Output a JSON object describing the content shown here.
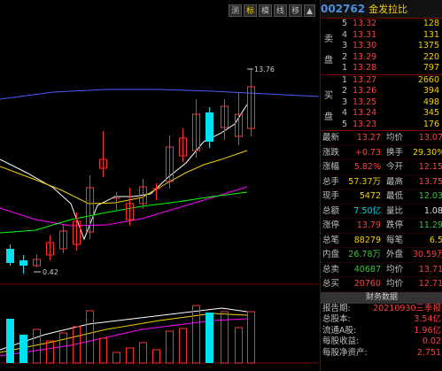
{
  "toolbar": {
    "buttons": [
      "测",
      "标",
      "模",
      "线",
      "移",
      "▲"
    ]
  },
  "stock": {
    "code": "002762",
    "name": "金发拉比"
  },
  "orderbook": {
    "sell_label": [
      "卖",
      "盘"
    ],
    "buy_label": [
      "买",
      "盘"
    ],
    "asks": [
      {
        "lvl": "5",
        "price": "13.32",
        "vol": "128"
      },
      {
        "lvl": "4",
        "price": "13.31",
        "vol": "131"
      },
      {
        "lvl": "3",
        "price": "13.30",
        "vol": "1375"
      },
      {
        "lvl": "2",
        "price": "13.29",
        "vol": "220"
      },
      {
        "lvl": "1",
        "price": "13.28",
        "vol": "797"
      }
    ],
    "bids": [
      {
        "lvl": "1",
        "price": "13.27",
        "vol": "2660"
      },
      {
        "lvl": "2",
        "price": "13.26",
        "vol": "394"
      },
      {
        "lvl": "3",
        "price": "13.25",
        "vol": "498"
      },
      {
        "lvl": "4",
        "price": "13.24",
        "vol": "345"
      },
      {
        "lvl": "5",
        "price": "13.23",
        "vol": "176"
      }
    ]
  },
  "quotes": [
    {
      "k1": "最新",
      "v1": "13.27",
      "c1": "red",
      "k2": "均价",
      "v2": "13.07",
      "c2": "red"
    },
    {
      "k1": "涨跌",
      "v1": "+0.73",
      "c1": "red",
      "k2": "换手",
      "v2": "29.30%",
      "c2": "yel"
    },
    {
      "k1": "涨幅",
      "v1": "5.82%",
      "c1": "red",
      "k2": "今开",
      "v2": "12.15",
      "c2": "red"
    },
    {
      "k1": "总手",
      "v1": "57.37万",
      "c1": "yel",
      "k2": "最高",
      "v2": "13.75",
      "c2": "red"
    },
    {
      "k1": "现手",
      "v1": "5472",
      "c1": "yel",
      "k2": "最低",
      "v2": "12.03",
      "c2": "grn"
    },
    {
      "k1": "总额",
      "v1": "7.50亿",
      "c1": "cyn",
      "k2": "量比",
      "v2": "1.08",
      "c2": "wht"
    },
    {
      "k1": "涨停",
      "v1": "13.79",
      "c1": "red",
      "k2": "跌停",
      "v2": "11.29",
      "c2": "grn"
    },
    {
      "k1": "总笔",
      "v1": "88279",
      "c1": "yel",
      "k2": "每笔",
      "v2": "6.5",
      "c2": "yel"
    },
    {
      "k1": "内盘",
      "v1": "26.78万",
      "c1": "grn",
      "k2": "外盘",
      "v2": "30.59万",
      "c2": "red"
    },
    {
      "k1": "总卖",
      "v1": "40687",
      "c1": "grn",
      "k2": "均价",
      "v2": "13.71",
      "c2": "red"
    },
    {
      "k1": "总买",
      "v1": "20760",
      "c1": "red",
      "k2": "均价",
      "v2": "12.71",
      "c2": "red"
    }
  ],
  "financials": {
    "header": "财务数据",
    "rows": [
      {
        "k": "报告期:",
        "v": "20210930三季报"
      },
      {
        "k": "总股本:",
        "v": "3.54亿"
      },
      {
        "k": "流通A股:",
        "v": "1.96亿"
      },
      {
        "k": "每股收益:",
        "v": "0.02"
      },
      {
        "k": "每股净资产:",
        "v": "2.751"
      }
    ]
  },
  "chart_labels": {
    "high": "13.76",
    "low": "0.42"
  },
  "colors": {
    "up": "#ff3030",
    "down": "#00e0f0",
    "ma5": "#ffffff",
    "ma10": "#f5d000",
    "ma20": "#ff00ff",
    "ma30": "#00ff00",
    "ma60": "#4a5cff"
  }
}
